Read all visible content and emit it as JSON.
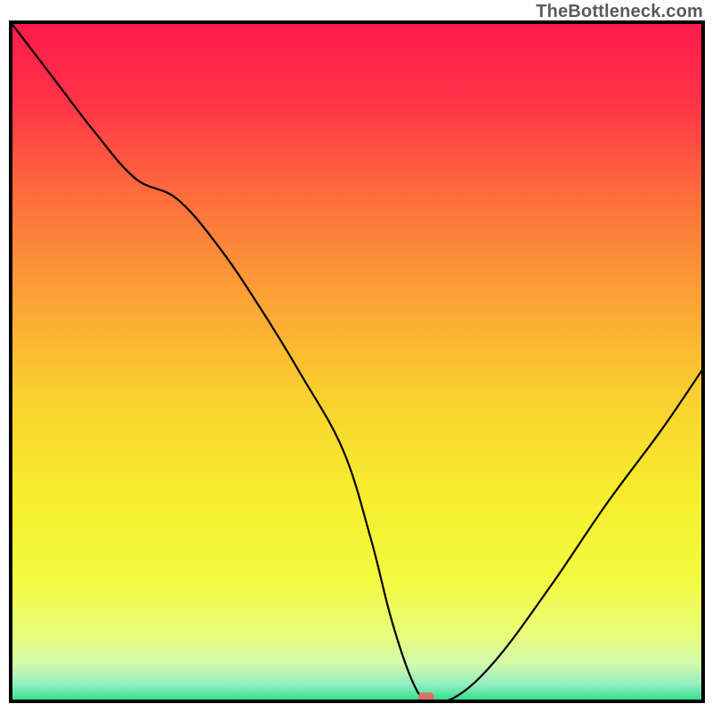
{
  "watermark": "TheBottleneck.com",
  "chart_data": {
    "type": "line",
    "title": "",
    "xlabel": "",
    "ylabel": "",
    "xlim": [
      0,
      100
    ],
    "ylim": [
      0,
      100
    ],
    "grid": false,
    "legend": false,
    "background": "vertical rainbow gradient, red (top) through orange, yellow, pale-yellow, to green (bottom)",
    "series": [
      {
        "name": "bottleneck-curve",
        "x": [
          0,
          6,
          12,
          18,
          24,
          30,
          36,
          42,
          48,
          52,
          55,
          58,
          60,
          64,
          70,
          78,
          86,
          94,
          100
        ],
        "y": [
          100,
          92,
          84,
          77,
          74,
          67,
          58,
          48,
          37,
          24,
          12,
          3,
          0.5,
          0.5,
          6,
          17,
          29,
          40,
          49
        ],
        "note": "Asymmetric V-shaped curve. Falls steeply from top-left corner, reaches minimum near x≈58–62 where y≈0, then rises more gently toward upper-right, ending near y≈49 at x=100."
      }
    ],
    "markers": [
      {
        "name": "optimal-point",
        "x": 60,
        "y": 0.5,
        "color": "#d6726a",
        "shape": "rounded-rect"
      }
    ],
    "gradient_stops": [
      {
        "offset": 0.0,
        "color": "#fe1a4a"
      },
      {
        "offset": 0.12,
        "color": "#fe3447"
      },
      {
        "offset": 0.25,
        "color": "#fd6b3d"
      },
      {
        "offset": 0.4,
        "color": "#fca035"
      },
      {
        "offset": 0.55,
        "color": "#fad02f"
      },
      {
        "offset": 0.7,
        "color": "#f6ee2d"
      },
      {
        "offset": 0.82,
        "color": "#f2fb40"
      },
      {
        "offset": 0.9,
        "color": "#e8fc79"
      },
      {
        "offset": 0.945,
        "color": "#d3f9ac"
      },
      {
        "offset": 0.975,
        "color": "#92eec0"
      },
      {
        "offset": 1.0,
        "color": "#2bdf8c"
      }
    ],
    "frame": {
      "stroke": "#000000",
      "stroke_width": 4,
      "inset_top": 25,
      "inset_left": 12,
      "inset_right": 10,
      "inset_bottom": 12
    }
  }
}
